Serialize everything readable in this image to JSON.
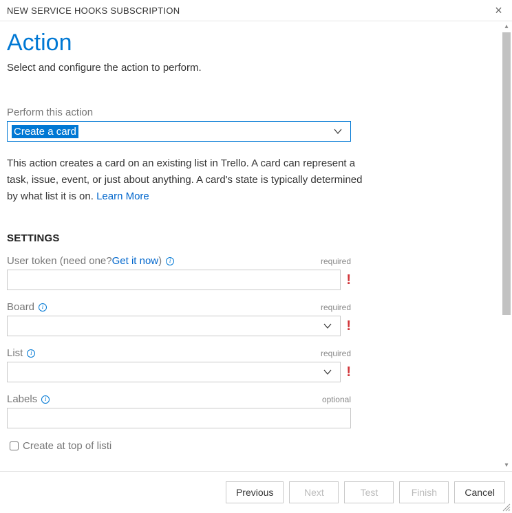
{
  "dialog": {
    "title": "NEW SERVICE HOOKS SUBSCRIPTION"
  },
  "header": {
    "title": "Action",
    "subtitle": "Select and configure the action to perform."
  },
  "action": {
    "label": "Perform this action",
    "selected": "Create a card",
    "description_prefix": "This action creates a card on an existing list in Trello. A card can represent a task, issue, event, or just about anything. A card's state is typically determined by what list it is on. ",
    "learn_more": "Learn More"
  },
  "settings": {
    "heading": "SETTINGS",
    "required_text": "required",
    "optional_text": "optional",
    "fields": {
      "user_token": {
        "label_prefix": "User token (need one? ",
        "link": "Get it now",
        "label_suffix": ")",
        "value": "",
        "required": true,
        "error": true
      },
      "board": {
        "label": "Board",
        "value": "",
        "required": true,
        "error": true
      },
      "list": {
        "label": "List",
        "value": "",
        "required": true,
        "error": true
      },
      "labels": {
        "label": "Labels",
        "value": "",
        "required": false
      },
      "create_top": {
        "label": "Create at top of list",
        "checked": false
      }
    }
  },
  "footer": {
    "previous": "Previous",
    "next": "Next",
    "test": "Test",
    "finish": "Finish",
    "cancel": "Cancel"
  }
}
